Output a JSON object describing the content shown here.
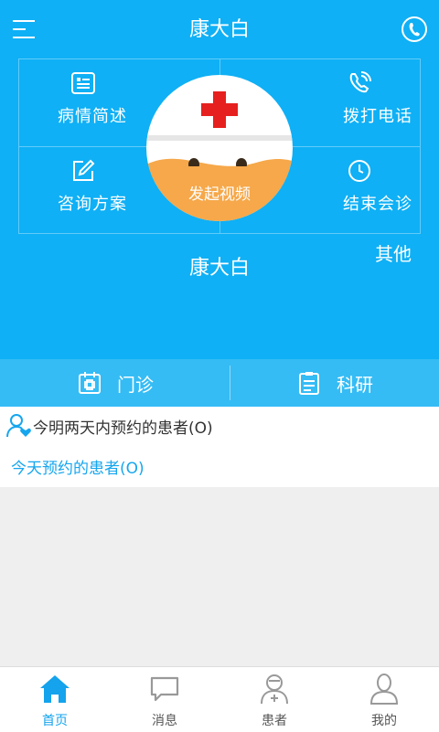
{
  "header": {
    "title": "康大白",
    "doctor_name": "康大白",
    "other_label": "其他"
  },
  "grid": {
    "top_left": {
      "label": "病情简述",
      "icon": "list-icon"
    },
    "top_right": {
      "label": "拨打电话",
      "icon": "phone-icon"
    },
    "bottom_left": {
      "label": "咨询方案",
      "icon": "edit-icon"
    },
    "bottom_right": {
      "label": "结束会诊",
      "icon": "clock-icon"
    }
  },
  "center_button": {
    "label": "发起视频"
  },
  "subtabs": [
    {
      "label": "门诊",
      "icon": "clinic-icon"
    },
    {
      "label": "科研",
      "icon": "clipboard-icon"
    }
  ],
  "appointments": {
    "two_days": "今明两天内预约的患者(O)",
    "today": "今天预约的患者(O)"
  },
  "bottom_nav": [
    {
      "label": "首页",
      "icon": "home-icon"
    },
    {
      "label": "消息",
      "icon": "message-icon"
    },
    {
      "label": "患者",
      "icon": "patient-icon"
    },
    {
      "label": "我的",
      "icon": "profile-icon"
    }
  ],
  "colors": {
    "primary": "#0fb0f5",
    "accent": "#14a3ec",
    "orange": "#f6a84a",
    "red": "#e6201e"
  }
}
